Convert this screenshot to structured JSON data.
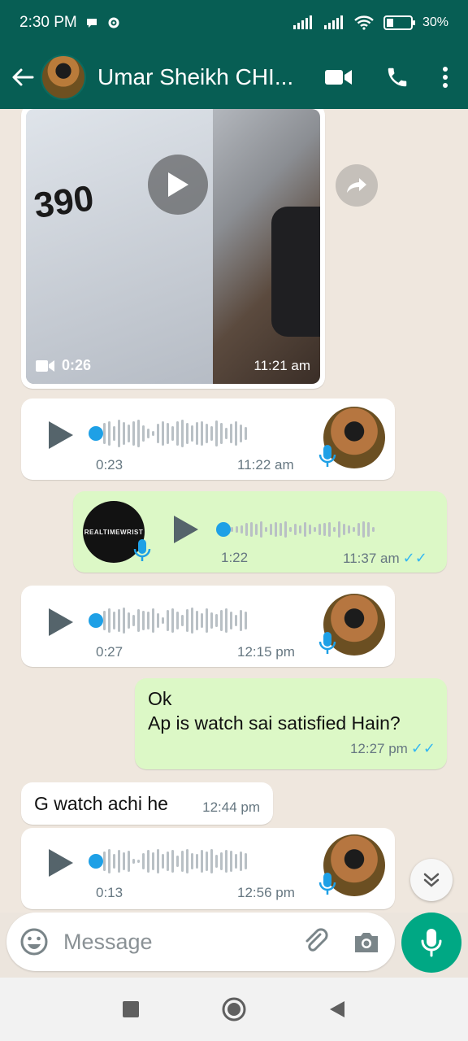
{
  "status_bar": {
    "time": "2:30 PM",
    "battery": "30%",
    "battery_level": 0.3
  },
  "header": {
    "contact_name": "Umar Sheikh CHI...",
    "back_icon": "arrow-left-icon",
    "video_call_icon": "video-camera-icon",
    "voice_call_icon": "phone-icon",
    "menu_icon": "more-vert-icon"
  },
  "messages": {
    "video": {
      "duration": "0:26",
      "time": "11:21 am",
      "thumbnail_text": "390"
    },
    "voice_1": {
      "duration": "0:23",
      "time": "11:22 am",
      "direction": "in"
    },
    "voice_2": {
      "duration": "1:22",
      "time": "11:37 am",
      "direction": "out",
      "avatar_text": "REALTIMEWRIST"
    },
    "voice_3": {
      "duration": "0:27",
      "time": "12:15 pm",
      "direction": "in"
    },
    "text_out": {
      "line1": "Ok",
      "line2": "Ap is watch sai satisfied Hain?",
      "time": "12:27 pm"
    },
    "text_in": {
      "text": "G watch achi he",
      "time": "12:44 pm"
    },
    "voice_4": {
      "duration": "0:13",
      "time": "12:56 pm",
      "direction": "in"
    }
  },
  "compose": {
    "placeholder": "Message"
  },
  "colors": {
    "header": "#075e54",
    "outgoing_bubble": "#dcf8c6",
    "accent": "#00a884",
    "read_ticks": "#34b7f1"
  }
}
